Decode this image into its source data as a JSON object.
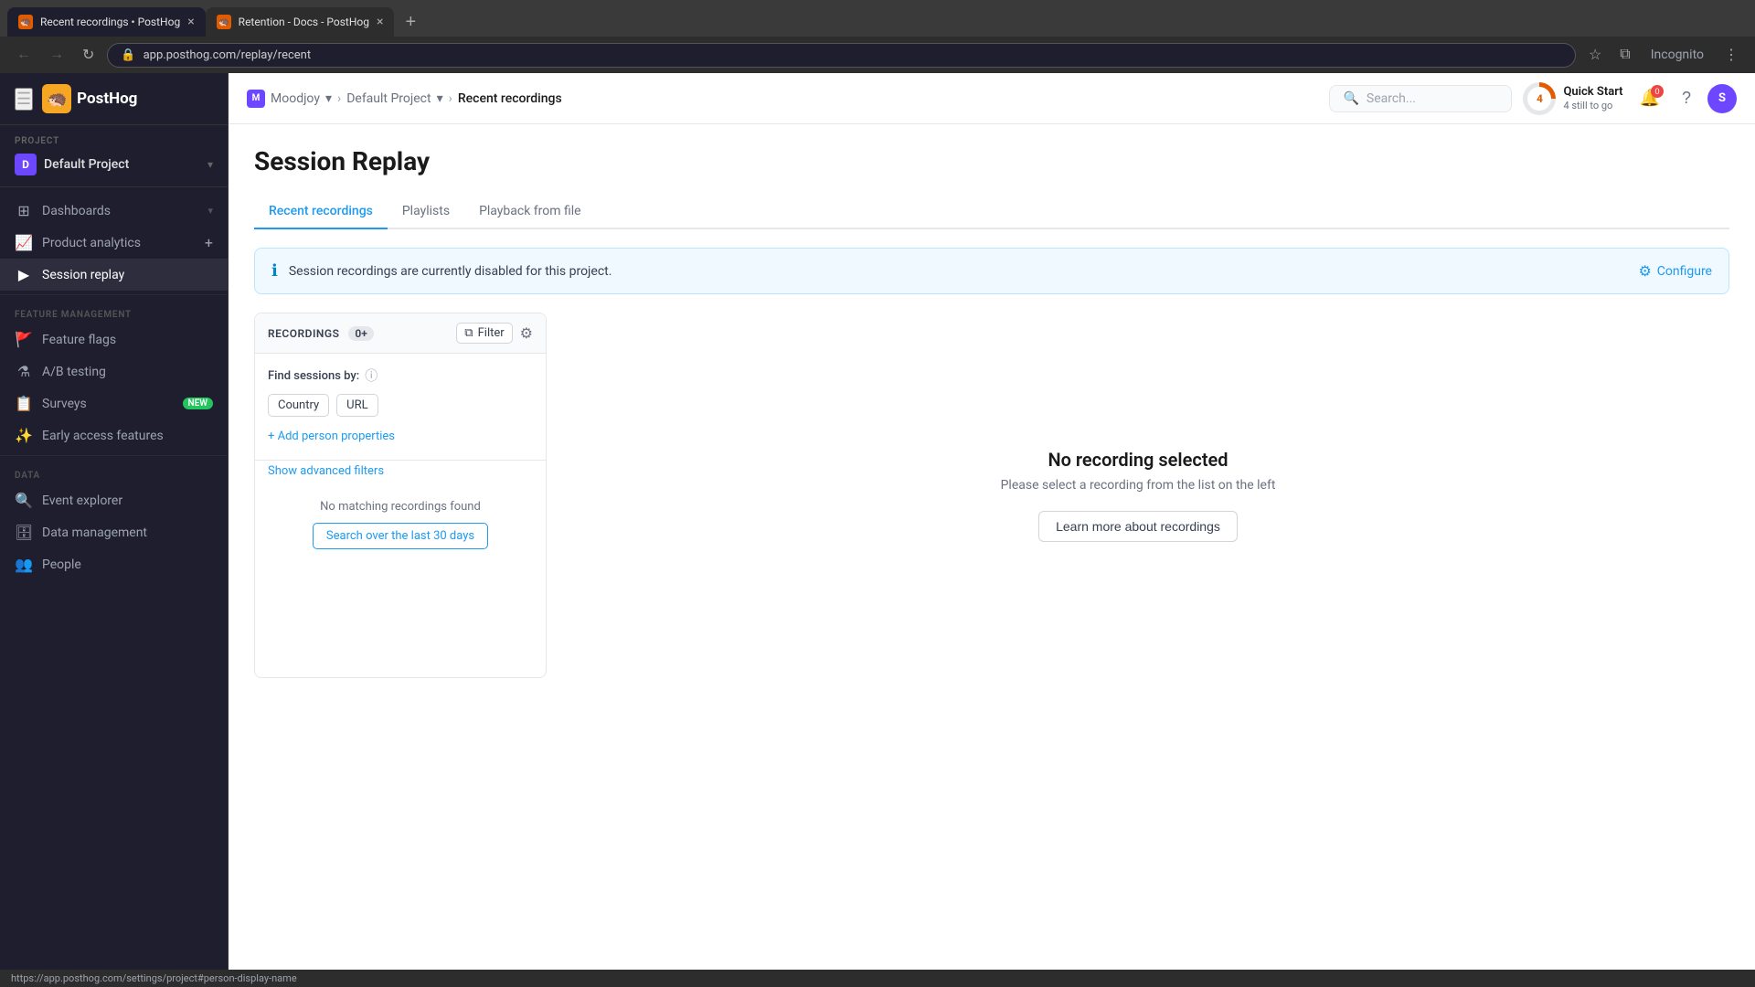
{
  "browser": {
    "tabs": [
      {
        "id": "tab1",
        "title": "Recent recordings • PostHog",
        "active": true,
        "favicon": "🦔"
      },
      {
        "id": "tab2",
        "title": "Retention - Docs - PostHog",
        "active": false,
        "favicon": "🦔"
      }
    ],
    "address": "app.posthog.com/replay/recent"
  },
  "header": {
    "search_placeholder": "Search...",
    "quick_start_title": "Quick Start",
    "quick_start_sub": "4 still to go",
    "quick_start_steps_done": 1,
    "quick_start_total": 4,
    "notification_count": "0",
    "user_initial": "S",
    "incognito_label": "Incognito"
  },
  "breadcrumb": {
    "org": "Moodjoy",
    "project": "Default Project",
    "current": "Recent recordings"
  },
  "sidebar": {
    "project_label": "PROJECT",
    "project_name": "Default Project",
    "project_initial": "D",
    "nav_items": [
      {
        "id": "dashboards",
        "label": "Dashboards",
        "icon": "⊞",
        "has_chevron": true
      },
      {
        "id": "product-analytics",
        "label": "Product analytics",
        "icon": "📈",
        "has_add": true
      },
      {
        "id": "session-replay",
        "label": "Session replay",
        "icon": "▶",
        "active": true
      },
      {
        "id": "feature-flags",
        "label": "Feature flags",
        "icon": "🚩"
      },
      {
        "id": "ab-testing",
        "label": "A/B testing",
        "icon": "⚗"
      },
      {
        "id": "surveys",
        "label": "Surveys",
        "icon": "📋",
        "badge": "NEW"
      },
      {
        "id": "early-access",
        "label": "Early access features",
        "icon": "✨"
      }
    ],
    "feature_management_label": "FEATURE MANAGEMENT",
    "data_label": "DATA",
    "data_items": [
      {
        "id": "event-explorer",
        "label": "Event explorer",
        "icon": "🔍"
      },
      {
        "id": "data-management",
        "label": "Data management",
        "icon": "🗄"
      },
      {
        "id": "people",
        "label": "People",
        "icon": "👥"
      }
    ]
  },
  "page": {
    "title": "Session Replay",
    "tabs": [
      {
        "id": "recent",
        "label": "Recent recordings",
        "active": true
      },
      {
        "id": "playlists",
        "label": "Playlists",
        "active": false
      },
      {
        "id": "playback",
        "label": "Playback from file",
        "active": false
      }
    ]
  },
  "alert": {
    "message": "Session recordings are currently disabled for this project.",
    "configure_label": "Configure"
  },
  "recordings": {
    "label": "RECORDINGS",
    "count": "0+",
    "filter_label": "Filter",
    "settings_icon": "⚙",
    "find_by_label": "Find sessions by:",
    "filters": [
      {
        "id": "country",
        "label": "Country"
      },
      {
        "id": "url",
        "label": "URL"
      }
    ],
    "add_filter_label": "+ Add person properties",
    "advanced_filters_label": "Show advanced filters",
    "no_results_label": "No matching recordings found",
    "search_30_days_label": "Search over the last 30 days"
  },
  "right_panel": {
    "title": "No recording selected",
    "subtitle": "Please select a recording from the list on the left",
    "learn_more_label": "Learn more about recordings"
  },
  "status_bar": {
    "url": "https://app.posthog.com/settings/project#person-display-name"
  }
}
